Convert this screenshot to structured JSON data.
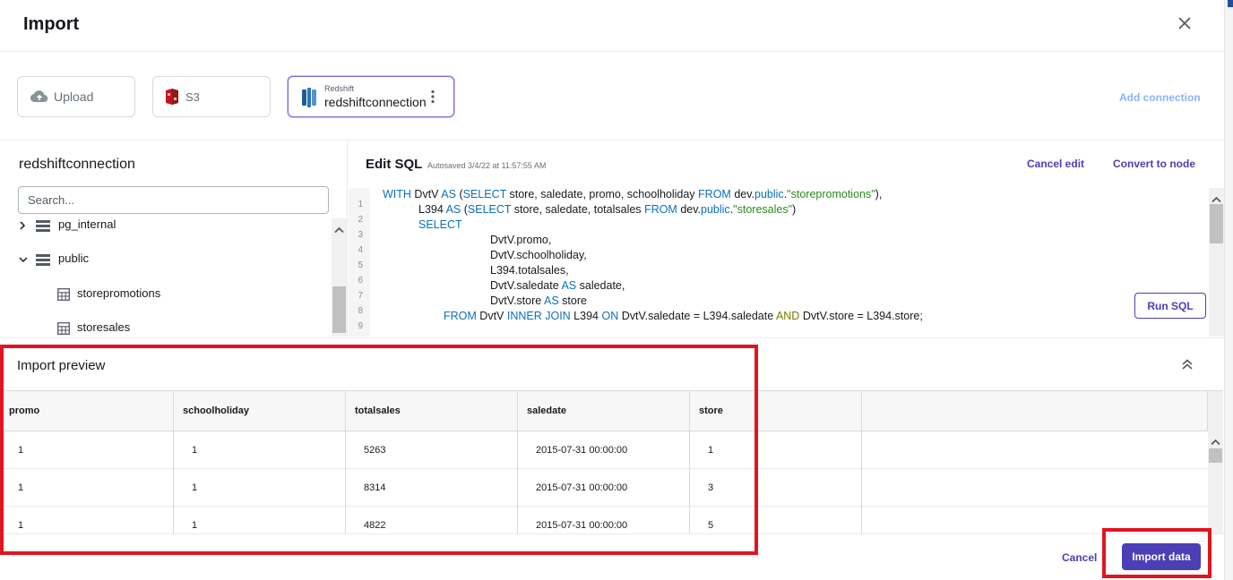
{
  "dialog": {
    "title": "Import"
  },
  "connections": {
    "upload_label": "Upload",
    "s3_label": "S3",
    "redshift_type": "Redshift",
    "redshift_name": "redshiftconnection",
    "add_connection": "Add connection"
  },
  "browser": {
    "title": "redshiftconnection",
    "search_placeholder": "Search...",
    "tree": [
      {
        "label": "pg_internal",
        "kind": "schema",
        "expanded": false
      },
      {
        "label": "public",
        "kind": "schema",
        "expanded": true
      },
      {
        "label": "storepromotions",
        "kind": "table"
      },
      {
        "label": "storesales",
        "kind": "table"
      }
    ]
  },
  "editor": {
    "title": "Edit SQL",
    "autosaved": "Autosaved 3/4/22 at 11:57:55 AM",
    "cancel_edit": "Cancel edit",
    "convert_to_node": "Convert to node",
    "run_sql": "Run SQL",
    "line_numbers": [
      "1",
      "2",
      "3",
      "4",
      "5",
      "6",
      "7",
      "8",
      "9"
    ]
  },
  "preview": {
    "title": "Import preview",
    "columns": [
      "promo",
      "schoolholiday",
      "totalsales",
      "saledate",
      "store"
    ],
    "rows": [
      [
        "1",
        "1",
        "5263",
        "2015-07-31 00:00:00",
        "1"
      ],
      [
        "1",
        "1",
        "8314",
        "2015-07-31 00:00:00",
        "3"
      ],
      [
        "1",
        "1",
        "4822",
        "2015-07-31 00:00:00",
        "5"
      ]
    ]
  },
  "footer": {
    "cancel": "Cancel",
    "import_data": "Import data"
  },
  "colors": {
    "accent": "#4b3fb6",
    "highlight": "#e0151f",
    "keyword": "#0b70b9",
    "string": "#2f8a1f"
  }
}
